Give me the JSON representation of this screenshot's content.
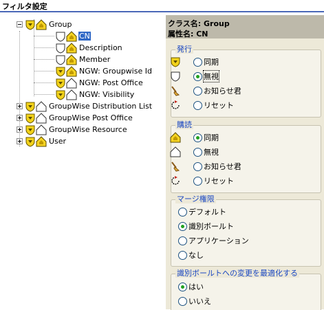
{
  "window_title": "フィルタ設定",
  "tree": {
    "group": "Group",
    "children": [
      "CN",
      "Description",
      "Member",
      "NGW: Groupwise Id",
      "NGW: Post Office",
      "NGW: Visibility"
    ],
    "others": [
      "GroupWise Distribution List",
      "GroupWise Post Office",
      "GroupWise Resource",
      "User"
    ]
  },
  "header": {
    "class_line": "クラス名: Group",
    "attr_line": "属性名: CN"
  },
  "publish": {
    "title": "発行",
    "options": [
      "同期",
      "無視",
      "お知らせ君",
      "リセット"
    ],
    "selected": "無視"
  },
  "subscribe": {
    "title": "購読",
    "options": [
      "同期",
      "無視",
      "お知らせ君",
      "リセット"
    ],
    "selected": "同期"
  },
  "merge": {
    "title": "マージ権限",
    "options": [
      "デフォルト",
      "識別ボールト",
      "アプリケーション",
      "なし"
    ],
    "selected": "識別ボールト"
  },
  "optimize": {
    "title": "識別ボールトへの変更を最適化する",
    "options": [
      "はい",
      "いいえ"
    ],
    "selected": "はい"
  },
  "icons": {
    "sync": "sync-arrow-icon",
    "ignore": "ignore-shield-icon",
    "notify": "notify-broom-icon",
    "reset": "reset-arrow-icon",
    "class": "class-house-icon",
    "attribute": "attribute-shield-icon"
  },
  "colors": {
    "selection": "#3169c6",
    "group_title": "#1a47c2",
    "panel_bg": "#ede9d8",
    "header_bg": "#bdb9aa",
    "radio_dot": "#21a121"
  }
}
